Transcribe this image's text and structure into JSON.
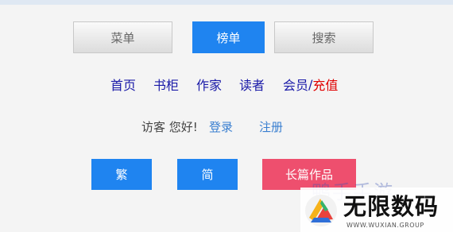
{
  "toolbar": {
    "menu": "菜单",
    "ranking": "榜单",
    "search": "搜索"
  },
  "nav": {
    "home": "首页",
    "bookshelf": "书柜",
    "authors": "作家",
    "readers": "读者",
    "member": "会员",
    "sep": "/",
    "recharge": "充值"
  },
  "greeting": {
    "text": "访客 您好!",
    "login": "登录",
    "register": "注册"
  },
  "buttons": {
    "traditional": "繁",
    "simplified": "简",
    "long_works": "长篇作品"
  },
  "watermark": {
    "faint_text": "鸭手手游",
    "title": "无限数码",
    "subtitle": "WWW.WUXIAN.GROUP"
  },
  "colors": {
    "accent_blue": "#1f84f0",
    "nav_text": "#1a1aa8",
    "recharge_red": "#e00000",
    "long_works_pink": "#ee4f6e",
    "link_blue": "#3a7fd0"
  }
}
